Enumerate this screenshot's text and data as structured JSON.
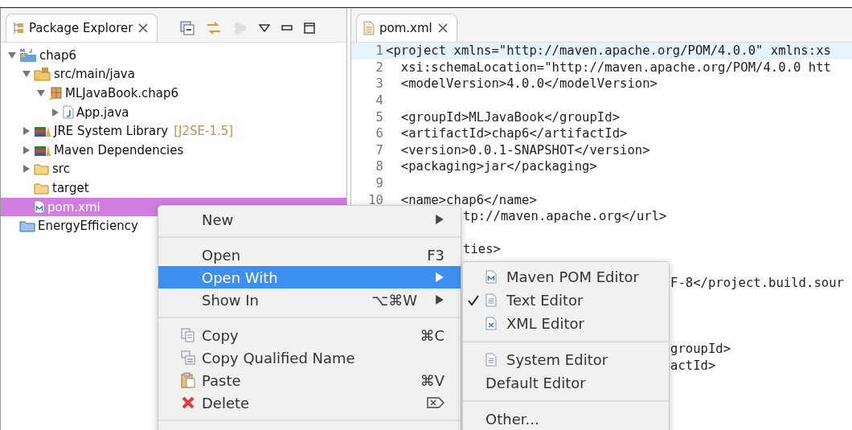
{
  "explorer": {
    "tab": {
      "label": "Package Explorer",
      "selected": true
    },
    "tree": [
      {
        "label": "chap6",
        "kind": "project",
        "expanded": true,
        "selected": false,
        "children": [
          {
            "label": "src/main/java",
            "kind": "source-folder",
            "expanded": true,
            "selected": false,
            "children": [
              {
                "label": "MLJavaBook.chap6",
                "kind": "package",
                "expanded": true,
                "selected": false,
                "children": [
                  {
                    "label": "App.java",
                    "kind": "java-file",
                    "expanded": false,
                    "selected": false
                  }
                ]
              }
            ]
          },
          {
            "label": "JRE System Library",
            "suffix": "[J2SE-1.5]",
            "kind": "library",
            "expanded": false,
            "selected": false
          },
          {
            "label": "Maven Dependencies",
            "kind": "library",
            "expanded": false,
            "selected": false
          },
          {
            "label": "src",
            "kind": "folder",
            "expanded": false,
            "selected": false
          },
          {
            "label": "target",
            "kind": "folder",
            "selected": false
          },
          {
            "label": "pom.xml",
            "kind": "xml-file",
            "selected": true
          }
        ]
      },
      {
        "label": "EnergyEfficiency",
        "kind": "closed-project",
        "selected": false
      }
    ]
  },
  "editor": {
    "tab": {
      "label": "pom.xml",
      "selected": true
    },
    "lines": [
      {
        "number": "1",
        "text": "<project xmlns=\"http://maven.apache.org/POM/4.0.0\" xmlns:xs",
        "kind": "full",
        "current": true
      },
      {
        "number": "2",
        "text": "  xsi:schemaLocation=\"http://maven.apache.org/POM/4.0.0 htt",
        "kind": "full",
        "current": false
      },
      {
        "number": "3",
        "text": "  <modelVersion>4.0.0</modelVersion>",
        "kind": "full",
        "current": false
      },
      {
        "number": "4",
        "kind": "full",
        "current": false
      },
      {
        "number": "5",
        "text": "  <groupId>MLJavaBook</groupId>",
        "kind": "full",
        "current": false
      },
      {
        "number": "6",
        "text": "  <artifactId>chap6</artifactId>",
        "kind": "full",
        "current": false
      },
      {
        "number": "7",
        "text": "  <version>0.0.1-SNAPSHOT</version>",
        "kind": "full",
        "current": false
      },
      {
        "number": "8",
        "text": "  <packaging>jar</packaging>",
        "kind": "full",
        "current": false
      },
      {
        "number": "9",
        "kind": "full",
        "current": false
      },
      {
        "number": "10",
        "text": "  <name>chap6</name>",
        "kind": "full",
        "current": false
      },
      {
        "text": "tp://maven.apache.org</url>",
        "kind": "after_menu",
        "current": false
      },
      {
        "kind": "after_menu",
        "current": false
      },
      {
        "text": "ties>",
        "kind": "after_menu",
        "current": false
      },
      {
        "kind": "after_menu",
        "current": false
      },
      {
        "text": "F-8</project.build.sour",
        "kind": "after_submenu",
        "current": false
      },
      {
        "kind": "after_menu",
        "current": false
      },
      {
        "kind": "after_menu",
        "current": false
      },
      {
        "kind": "after_menu",
        "current": false
      },
      {
        "text": "groupId>",
        "kind": "after_submenu",
        "current": false
      },
      {
        "text": "actId>",
        "kind": "after_submenu",
        "current": false
      }
    ]
  },
  "context_menu": {
    "items": [
      {
        "kind": "plain",
        "label": "New",
        "submenu": true,
        "selected": false
      },
      {
        "kind": "separator"
      },
      {
        "kind": "plain",
        "label": "Open",
        "shortcut": "F3",
        "submenu": false,
        "selected": false
      },
      {
        "kind": "plain",
        "label": "Open With",
        "submenu": true,
        "selected": true
      },
      {
        "kind": "plain",
        "label": "Show In",
        "shortcut": "⌥⌘W",
        "submenu": true,
        "selected": false
      },
      {
        "kind": "separator"
      },
      {
        "kind": "copy",
        "label": "Copy",
        "shortcut": "⌘C",
        "submenu": false,
        "selected": false
      },
      {
        "kind": "copy-qualified",
        "label": "Copy Qualified Name",
        "submenu": false,
        "selected": false
      },
      {
        "kind": "paste",
        "label": "Paste",
        "shortcut": "⌘V",
        "submenu": false,
        "selected": false
      },
      {
        "kind": "delete",
        "label": "Delete",
        "submenu": false,
        "selected": false
      },
      {
        "kind": "separator"
      }
    ]
  },
  "submenu": {
    "items": [
      {
        "kind": "maven",
        "label": "Maven POM Editor",
        "checked": false
      },
      {
        "kind": "text",
        "label": "Text Editor",
        "checked": true
      },
      {
        "kind": "xml",
        "label": "XML Editor",
        "checked": false
      },
      {
        "kind": "separator"
      },
      {
        "kind": "text",
        "label": "System Editor",
        "checked": false
      },
      {
        "kind": "plain",
        "label": "Default Editor",
        "checked": false
      },
      {
        "kind": "separator"
      },
      {
        "kind": "plain",
        "label": "Other...",
        "checked": false
      }
    ]
  }
}
